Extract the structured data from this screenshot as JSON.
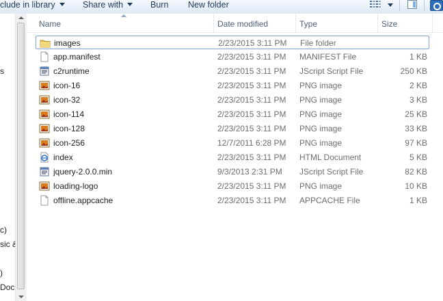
{
  "toolbar": {
    "include_library": "clude in library",
    "share_with": "Share with",
    "burn": "Burn",
    "new_folder": "New folder"
  },
  "nav_fragments": [
    "s",
    "c)",
    "sic &",
    ")",
    "Doc"
  ],
  "columns": {
    "name": "Name",
    "date": "Date modified",
    "type": "Type",
    "size": "Size"
  },
  "files": [
    {
      "name": "images",
      "date": "2/23/2015 3:11 PM",
      "type": "File folder",
      "size": "",
      "icon": "folder-icon"
    },
    {
      "name": "app.manifest",
      "date": "2/23/2015 3:11 PM",
      "type": "MANIFEST File",
      "size": "1 KB",
      "icon": "file-icon"
    },
    {
      "name": "c2runtime",
      "date": "2/23/2015 3:11 PM",
      "type": "JScript Script File",
      "size": "250 KB",
      "icon": "script-icon"
    },
    {
      "name": "icon-16",
      "date": "2/23/2015 3:11 PM",
      "type": "PNG image",
      "size": "2 KB",
      "icon": "png-icon"
    },
    {
      "name": "icon-32",
      "date": "2/23/2015 3:11 PM",
      "type": "PNG image",
      "size": "3 KB",
      "icon": "png-icon"
    },
    {
      "name": "icon-114",
      "date": "2/23/2015 3:11 PM",
      "type": "PNG image",
      "size": "25 KB",
      "icon": "png-icon"
    },
    {
      "name": "icon-128",
      "date": "2/23/2015 3:11 PM",
      "type": "PNG image",
      "size": "33 KB",
      "icon": "png-icon"
    },
    {
      "name": "icon-256",
      "date": "12/7/2011 6:28 PM",
      "type": "PNG image",
      "size": "97 KB",
      "icon": "png-icon"
    },
    {
      "name": "index",
      "date": "2/23/2015 3:11 PM",
      "type": "HTML Document",
      "size": "5 KB",
      "icon": "html-icon"
    },
    {
      "name": "jquery-2.0.0.min",
      "date": "9/3/2013 2:31 PM",
      "type": "JScript Script File",
      "size": "82 KB",
      "icon": "script-icon"
    },
    {
      "name": "loading-logo",
      "date": "2/23/2015 3:11 PM",
      "type": "PNG image",
      "size": "10 KB",
      "icon": "png-icon"
    },
    {
      "name": "offline.appcache",
      "date": "2/23/2015 3:11 PM",
      "type": "APPCACHE File",
      "size": "1 KB",
      "icon": "file-icon"
    }
  ]
}
